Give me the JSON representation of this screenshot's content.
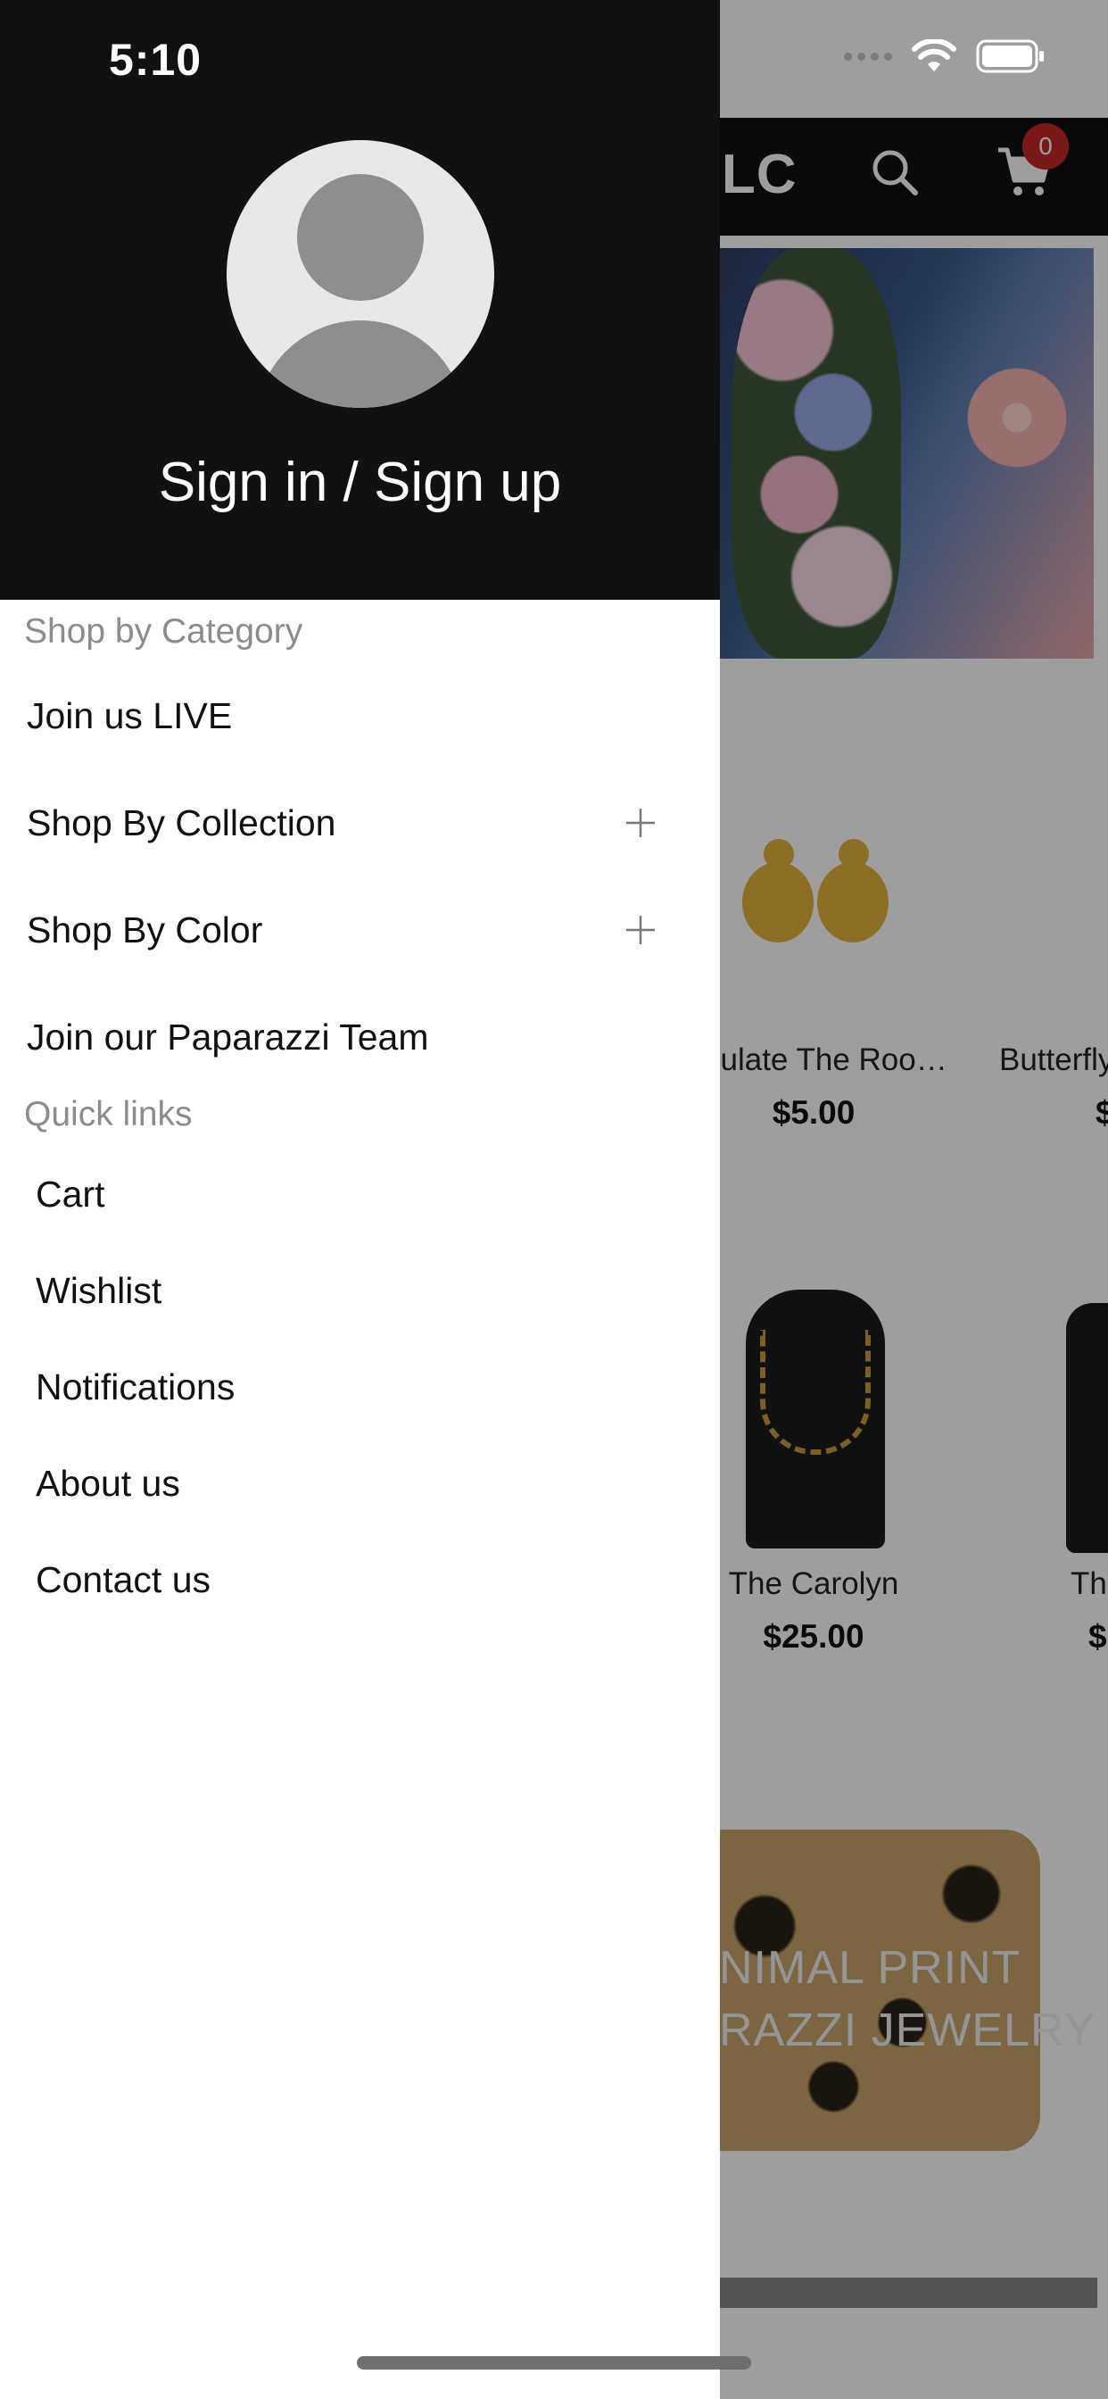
{
  "status_bar": {
    "time": "5:10"
  },
  "background": {
    "store_title_fragment": "LLC",
    "cart_count": "0",
    "products_row1": [
      {
        "name": "culate The Roo…",
        "price": "$5.00"
      },
      {
        "name": "Butterfly",
        "price": "$"
      }
    ],
    "products_row2": [
      {
        "name": "The Carolyn",
        "price": "$25.00"
      },
      {
        "name": "Th",
        "price": "$"
      }
    ],
    "banner_line1": "NIMAL PRINT",
    "banner_line2": "RAZZI JEWELRY"
  },
  "drawer": {
    "sign_in_label": "Sign in / Sign up",
    "category_section_label": "Shop by Category",
    "categories": [
      {
        "label": "Join us LIVE",
        "expandable": false
      },
      {
        "label": "Shop By Collection",
        "expandable": true
      },
      {
        "label": "Shop By Color",
        "expandable": true
      },
      {
        "label": "Join our Paparazzi Team",
        "expandable": false
      }
    ],
    "quick_links_label": "Quick links",
    "quick_links": [
      "Cart",
      "Wishlist",
      "Notifications",
      "About us",
      "Contact us"
    ]
  }
}
